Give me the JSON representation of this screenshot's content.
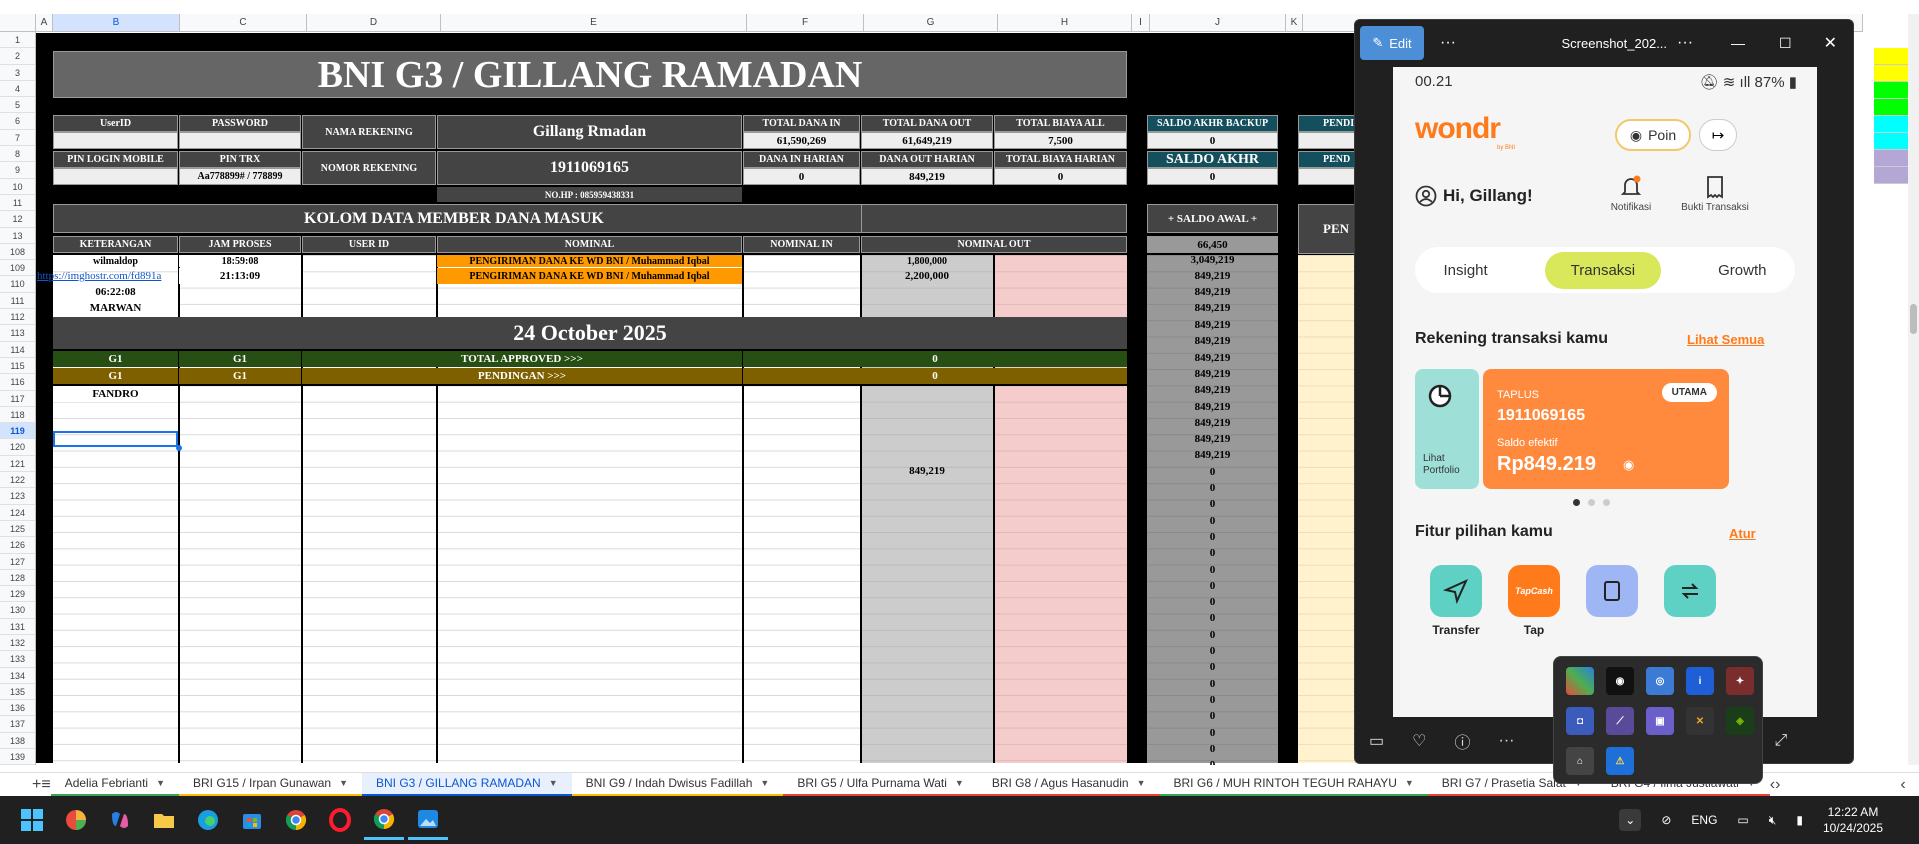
{
  "sheet": {
    "col_headers": [
      "A",
      "B",
      "C",
      "D",
      "E",
      "F",
      "G",
      "H",
      "I",
      "J",
      "K"
    ],
    "row_numbers": [
      "1",
      "2",
      "3",
      "4",
      "5",
      "6",
      "7",
      "8",
      "9",
      "10",
      "11",
      "12",
      "13",
      "108",
      "109",
      "110",
      "111",
      "112",
      "113",
      "114",
      "115",
      "116",
      "117",
      "118",
      "119",
      "120",
      "121",
      "122",
      "123",
      "124",
      "125",
      "126",
      "127",
      "128",
      "129",
      "130",
      "131",
      "132",
      "133",
      "134",
      "135",
      "136",
      "137",
      "138",
      "139"
    ],
    "selected_row": "119",
    "title": "BNI G3 / GILLANG RAMADAN",
    "userid_label": "UserID",
    "password_label": "PASSWORD",
    "nama_rekening_label": "NAMA REKENING",
    "nama_rekening_value": "Gillang Rmadan",
    "total_dana_in_label": "TOTAL DANA IN",
    "total_dana_in_value": "61,590,269",
    "total_dana_out_label": "TOTAL DANA OUT",
    "total_dana_out_value": "61,649,219",
    "total_biaya_all_label": "TOTAL BIAYA ALL",
    "total_biaya_all_value": "7,500",
    "saldo_backup_label": "SALDO AKHR BACKUP",
    "saldo_backup_value": "0",
    "pend_label_1": "PENDI",
    "pin_login_label": "PIN LOGIN MOBILE",
    "pin_trx_label": "PIN TRX",
    "pin_trx_value": "Aa778899# / 778899",
    "nomor_rekening_label": "NOMOR REKENING",
    "nomor_rekening_value": "1911069165",
    "dana_in_harian_label": "DANA IN HARIAN",
    "dana_in_harian_value": "0",
    "dana_out_harian_label": "DANA OUT HARIAN",
    "dana_out_harian_value": "849,219",
    "total_biaya_harian_label": "TOTAL BIAYA HARIAN",
    "total_biaya_harian_value": "0",
    "saldo_akhr_label": "SALDO AKHR",
    "saldo_akhr_value": "0",
    "pend_label_2": "PEND",
    "nohp": "NO.HP : 085959438331",
    "kolom_title": "KOLOM DATA MEMBER DANA MASUK",
    "saldo_awal_label": "+ SALDO AWAL +",
    "saldo_awal_value": "66,450",
    "pend_label_3": "PEN",
    "headers": [
      "KETERANGAN",
      "JAM PROSES",
      "USER ID",
      "NOMINAL",
      "NOMINAL IN",
      "NOMINAL OUT"
    ],
    "row108": {
      "ket": "wilmaldop",
      "jam": "18:59:08",
      "nominal": "PENGIRIMAN DANA KE WD BNI  / Muhammad Iqbal",
      "out": "1,800,000",
      "saldo": "3,049,219"
    },
    "row109": {
      "ket": "https://imghostr.com/fd891a",
      "jam": "21:13:09",
      "nominal": "PENGIRIMAN DANA KE WD BNI  / Muhammad Iqbal",
      "out": "2,200,000",
      "saldo": "849,219"
    },
    "row110": {
      "ket": "06:22:08",
      "saldo": "849,219"
    },
    "row111": {
      "ket": "MARWAN",
      "saldo": "849,219"
    },
    "date_banner": "24 October 2025",
    "approved": {
      "b": "G1",
      "c": "G1",
      "label": "TOTAL APPROVED >>>",
      "value": "0"
    },
    "pending": {
      "b": "G1",
      "c": "G1",
      "label": "PENDINGAN >>>",
      "value": "0"
    },
    "row116_ket": "FANDRO",
    "row121_out": "849,219",
    "saldo_col": [
      "849,219",
      "849,219",
      "849,219",
      "849,219",
      "849,219",
      "849,219",
      "849,219",
      "849,219",
      "849,219",
      "0",
      "0",
      "0",
      "0",
      "0",
      "0",
      "0",
      "0",
      "0",
      "0",
      "0",
      "0",
      "0",
      "0",
      "0",
      "0",
      "0",
      "0",
      "0"
    ]
  },
  "tabs": {
    "items": [
      {
        "label": "Adelia Febrianti",
        "color": "#34a853"
      },
      {
        "label": "BRI G15 / Irpan Gunawan",
        "color": "#fbbc04"
      },
      {
        "label": "BNI G3 / GILLANG RAMADAN",
        "color": "#0b57d0"
      },
      {
        "label": "BNI G9 / Indah Dwisus Fadillah",
        "color": "#fbbc04"
      },
      {
        "label": "BRI G5 / Ulfa Purnama Wati",
        "color": "#ea4335"
      },
      {
        "label": "BRI G8 / Agus Hasanudin",
        "color": "#ea4335"
      },
      {
        "label": "BRI G6 / MUH RINTOH TEGUH RAHAYU",
        "color": "#34a853"
      },
      {
        "label": "BRI G7 / Prasetia Salat",
        "color": "#ea4335"
      },
      {
        "label": "BRI G4 / Ilma Justiawati",
        "color": "#ea4335"
      }
    ]
  },
  "viewer": {
    "edit_label": "Edit",
    "title": "Screenshot_202...",
    "phone": {
      "time": "00.21",
      "battery": "87%",
      "brand": "wondr",
      "brand_sub": "by BNI",
      "poin_label": "Poin",
      "greeting": "Hi, Gillang!",
      "notif_label": "Notifikasi",
      "bukti_label": "Bukti Transaksi",
      "seg": [
        "Insight",
        "Transaksi",
        "Growth"
      ],
      "rek_title": "Rekening transaksi kamu",
      "lihat_semua": "Lihat Semua",
      "portfolio_label": "Lihat Portfolio",
      "card_type": "TAPLUS",
      "card_number": "1911069165",
      "utama": "UTAMA",
      "saldo_label": "Saldo efektif",
      "saldo_value": "Rp849.219",
      "fitur_title": "Fitur pilihan kamu",
      "atur": "Atur",
      "features": [
        "Transfer",
        "Tap"
      ]
    }
  },
  "taskbar": {
    "lang": "ENG",
    "time": "12:22 AM",
    "date": "10/24/2025"
  }
}
